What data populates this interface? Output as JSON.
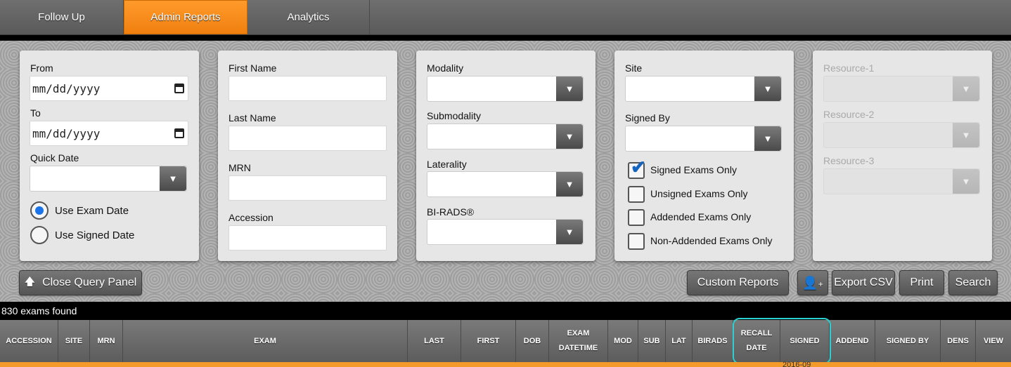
{
  "tabs": [
    "Follow Up",
    "Admin Reports",
    "Analytics"
  ],
  "dates": {
    "from_label": "From",
    "from_value": "mm/dd/yyyy",
    "to_label": "To",
    "to_value": "mm/dd/yyyy",
    "quick_date_label": "Quick Date",
    "use_exam_date": "Use Exam Date",
    "use_signed_date": "Use Signed Date"
  },
  "patient": {
    "first_name": "First Name",
    "last_name": "Last Name",
    "mrn": "MRN",
    "accession": "Accession"
  },
  "exam": {
    "modality": "Modality",
    "submodality": "Submodality",
    "laterality": "Laterality",
    "birads": "BI-RADS®"
  },
  "site": {
    "site_label": "Site",
    "signed_by_label": "Signed By",
    "options": [
      "Signed Exams Only",
      "Unsigned Exams Only",
      "Addended Exams Only",
      "Non-Addended Exams Only"
    ]
  },
  "resources": [
    "Resource-1",
    "Resource-2",
    "Resource-3"
  ],
  "buttons": {
    "close_query": "Close Query Panel",
    "custom_reports": "Custom Reports",
    "export_csv": "Export CSV",
    "print": "Print",
    "search": "Search"
  },
  "results": {
    "count_text": "830 exams found",
    "columns": [
      "ACCESSION",
      "SITE",
      "MRN",
      "EXAM",
      "LAST",
      "FIRST",
      "DOB",
      "EXAM DATETIME",
      "MOD",
      "SUB",
      "LAT",
      "BIRADS",
      "RECALL DATE",
      "SIGNED",
      "ADDEND",
      "SIGNED BY",
      "DENS",
      "VIEW"
    ],
    "first_row_peek": "2016-09"
  },
  "colors": {
    "accent": "#f08010",
    "highlight": "#2ad1d1",
    "check": "#1565c0"
  },
  "icons": {
    "arrow_up": "arrow-up-icon",
    "add_user": "add-user-icon",
    "dropdown": "chevron-down-icon",
    "calendar": "calendar-icon"
  }
}
